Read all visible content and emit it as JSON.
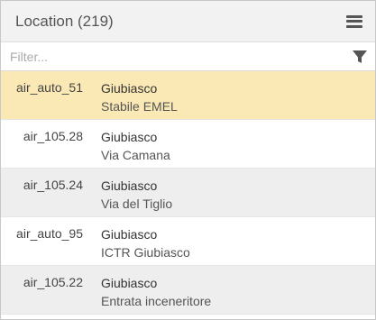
{
  "header": {
    "title": "Location (219)",
    "menu_icon": "hamburger-menu-icon"
  },
  "filter": {
    "placeholder": "Filter...",
    "value": "",
    "icon": "funnel-filter-icon"
  },
  "colors": {
    "selected_row": "#fbe9b5",
    "striped_row": "#eeeeee",
    "header_bg": "#f2f2f2"
  },
  "rows": [
    {
      "id": "air_auto_51",
      "city": "Giubiasco",
      "place": "Stabile EMEL",
      "selected": true
    },
    {
      "id": "air_105.28",
      "city": "Giubiasco",
      "place": "Via Camana",
      "selected": false
    },
    {
      "id": "air_105.24",
      "city": "Giubiasco",
      "place": "Via del Tiglio",
      "selected": false
    },
    {
      "id": "air_auto_95",
      "city": "Giubiasco",
      "place": "ICTR Giubiasco",
      "selected": false
    },
    {
      "id": "air_105.22",
      "city": "Giubiasco",
      "place": "Entrata inceneritore",
      "selected": false
    }
  ]
}
